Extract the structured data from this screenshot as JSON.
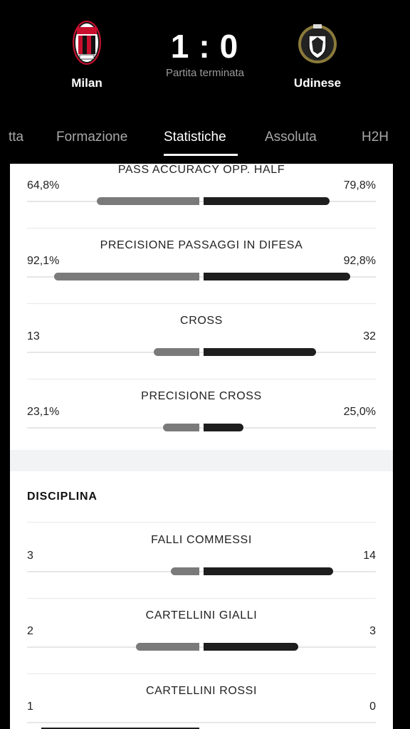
{
  "match": {
    "home_team": "Milan",
    "away_team": "Udinese",
    "home_score": "1",
    "away_score": "0",
    "separator": ":",
    "status": "Partita terminata"
  },
  "tabs": [
    {
      "label": "tta",
      "active": false
    },
    {
      "label": "Formazione",
      "active": false
    },
    {
      "label": "Statistiche",
      "active": true
    },
    {
      "label": "Assoluta",
      "active": false
    },
    {
      "label": "H2H",
      "active": false
    }
  ],
  "stats": [
    {
      "title": "PASS ACCURACY OPP. HALF",
      "home": "64,8%",
      "away": "79,8%",
      "home_frac": 0.648,
      "away_frac": 0.798
    },
    {
      "title": "PRECISIONE PASSAGGI IN DIFESA",
      "home": "92,1%",
      "away": "92,8%",
      "home_frac": 0.921,
      "away_frac": 0.928
    },
    {
      "title": "CROSS",
      "home": "13",
      "away": "32",
      "home_frac": 0.29,
      "away_frac": 0.71
    },
    {
      "title": "PRECISIONE CROSS",
      "home": "23,1%",
      "away": "25,0%",
      "home_frac": 0.231,
      "away_frac": 0.25
    }
  ],
  "discipline": {
    "title": "DISCIPLINA",
    "stats": [
      {
        "title": "FALLI COMMESSI",
        "home": "3",
        "away": "14",
        "home_frac": 0.18,
        "away_frac": 0.82
      },
      {
        "title": "CARTELLINI GIALLI",
        "home": "2",
        "away": "3",
        "home_frac": 0.4,
        "away_frac": 0.6
      },
      {
        "title": "CARTELLINI ROSSI",
        "home": "1",
        "away": "0",
        "home_frac": 1.0,
        "away_frac": 0.0
      }
    ]
  },
  "colors": {
    "background": "#000000",
    "panel": "#ffffff",
    "home_bar": "#7a7a7a",
    "away_bar": "#1e1e1e"
  }
}
